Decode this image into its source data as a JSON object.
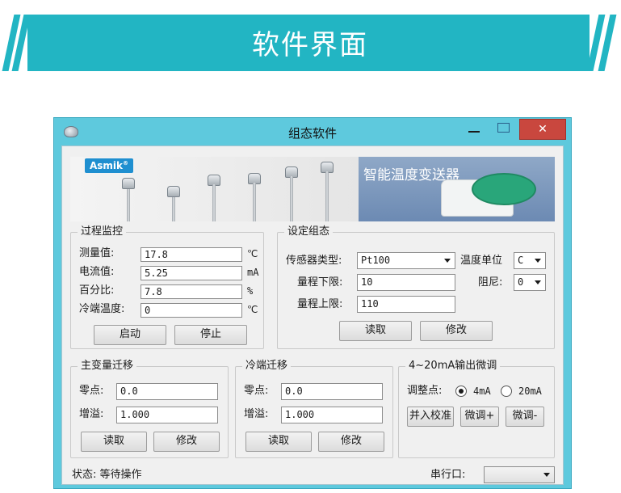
{
  "banner": {
    "title": "软件界面"
  },
  "window": {
    "title": "组态软件",
    "close_label": "✕"
  },
  "product": {
    "brand": "Asmik",
    "brand_mark": "®",
    "headline": "智能温度变送器"
  },
  "process": {
    "title": "过程监控",
    "rows": [
      {
        "label": "测量值:",
        "value": "17.8",
        "unit": "℃"
      },
      {
        "label": "电流值:",
        "value": "5.25",
        "unit": "mA"
      },
      {
        "label": "百分比:",
        "value": "7.8",
        "unit": "%"
      },
      {
        "label": "冷端温度:",
        "value": "0",
        "unit": "℃"
      }
    ],
    "start_label": "启动",
    "stop_label": "停止"
  },
  "config": {
    "title": "设定组态",
    "sensor_type_label": "传感器类型:",
    "sensor_type_value": "Pt100",
    "temp_unit_label": "温度单位",
    "temp_unit_value": "C",
    "range_low_label": "量程下限:",
    "range_low_value": "10",
    "damping_label": "阻尼:",
    "damping_value": "0",
    "range_high_label": "量程上限:",
    "range_high_value": "110",
    "read_label": "读取",
    "modify_label": "修改"
  },
  "pv_shift": {
    "title": "主变量迁移",
    "zero_label": "零点:",
    "zero_value": "0.0",
    "gain_label": "增溢:",
    "gain_value": "1.000",
    "read_label": "读取",
    "modify_label": "修改"
  },
  "cj_shift": {
    "title": "冷端迁移",
    "zero_label": "零点:",
    "zero_value": "0.0",
    "gain_label": "增溢:",
    "gain_value": "1.000",
    "read_label": "读取",
    "modify_label": "修改"
  },
  "trim": {
    "title": "4~20mA输出微调",
    "point_label": "调整点:",
    "opt_4ma": "4mA",
    "opt_20ma": "20mA",
    "selected": "4mA",
    "calibrate_label": "并入校准",
    "up_label": "微调+",
    "down_label": "微调-"
  },
  "status": {
    "text": "状态: 等待操作",
    "port_label": "串行口:",
    "port_value": ""
  },
  "colors": {
    "banner": "#22b5c3",
    "window_frame": "#5ec9dd",
    "close_button": "#c9473e",
    "client_bg": "#f0f0f0"
  }
}
